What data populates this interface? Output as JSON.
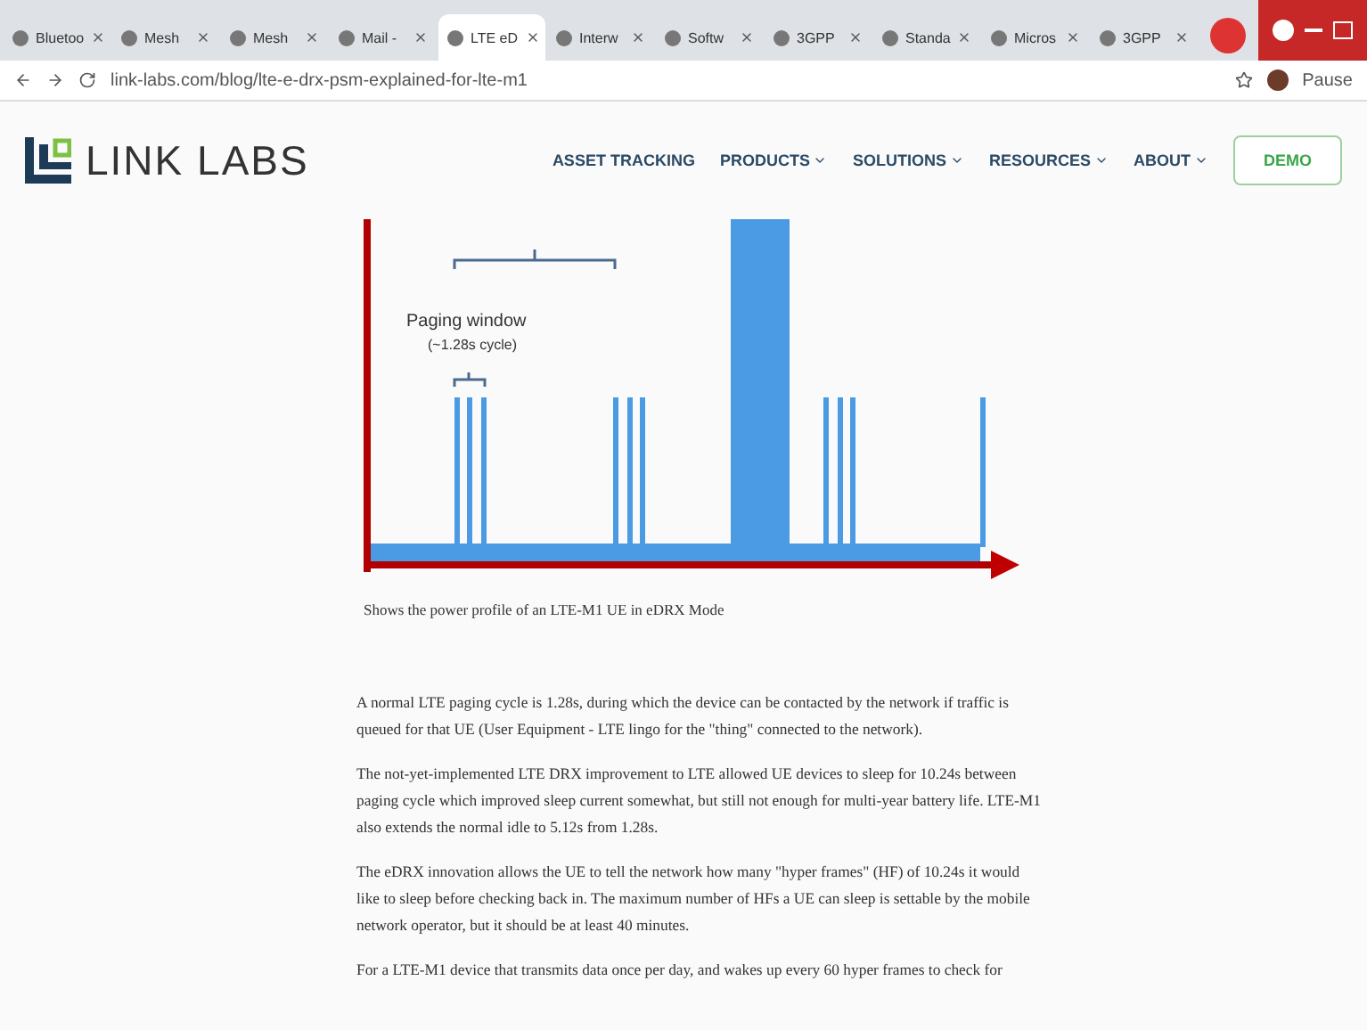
{
  "browser": {
    "tabs": [
      {
        "label": "Bluetoo",
        "selected": false
      },
      {
        "label": "Mesh",
        "selected": false
      },
      {
        "label": "Mesh",
        "selected": false
      },
      {
        "label": "Mail -",
        "selected": false
      },
      {
        "label": "LTE eD",
        "selected": true
      },
      {
        "label": "Interw",
        "selected": false
      },
      {
        "label": "Softw",
        "selected": false
      },
      {
        "label": "3GPP",
        "selected": false
      },
      {
        "label": "Standa",
        "selected": false
      },
      {
        "label": "Micros",
        "selected": false
      },
      {
        "label": "3GPP",
        "selected": false
      }
    ],
    "url": "link-labs.com/blog/lte-e-drx-psm-explained-for-lte-m1",
    "profile": "Pause"
  },
  "site": {
    "logo": "LINK LABS",
    "nav": [
      {
        "label": "ASSET TRACKING",
        "dropdown": false
      },
      {
        "label": "PRODUCTS",
        "dropdown": true
      },
      {
        "label": "SOLUTIONS",
        "dropdown": true
      },
      {
        "label": "RESOURCES",
        "dropdown": true
      },
      {
        "label": "ABOUT",
        "dropdown": true
      }
    ],
    "demo": "DEMO"
  },
  "figure": {
    "labels": [
      "Paging window",
      "(~1.28s cycle)"
    ],
    "caption": "Shows the power profile of an LTE-M1 UE in eDRX Mode"
  },
  "paragraphs": [
    "A normal LTE paging cycle is 1.28s, during which the device can be contacted by the network if traffic is queued for that UE (User Equipment - LTE lingo for the \"thing\" connected to the network).",
    "The not-yet-implemented LTE DRX improvement to LTE allowed UE devices to sleep for 10.24s between paging cycle which improved sleep current somewhat, but still not enough for multi-year battery life. LTE-M1 also extends the normal idle to 5.12s from 1.28s.",
    "The eDRX innovation allows the UE to tell the network how many \"hyper frames\" (HF) of 10.24s it would like to sleep before checking back in. The maximum number of HFs a UE can sleep is settable by the mobile network operator, but it should be at least 40 minutes.",
    "For a LTE-M1 device that transmits data once per day, and wakes up every 60 hyper frames to check for"
  ]
}
